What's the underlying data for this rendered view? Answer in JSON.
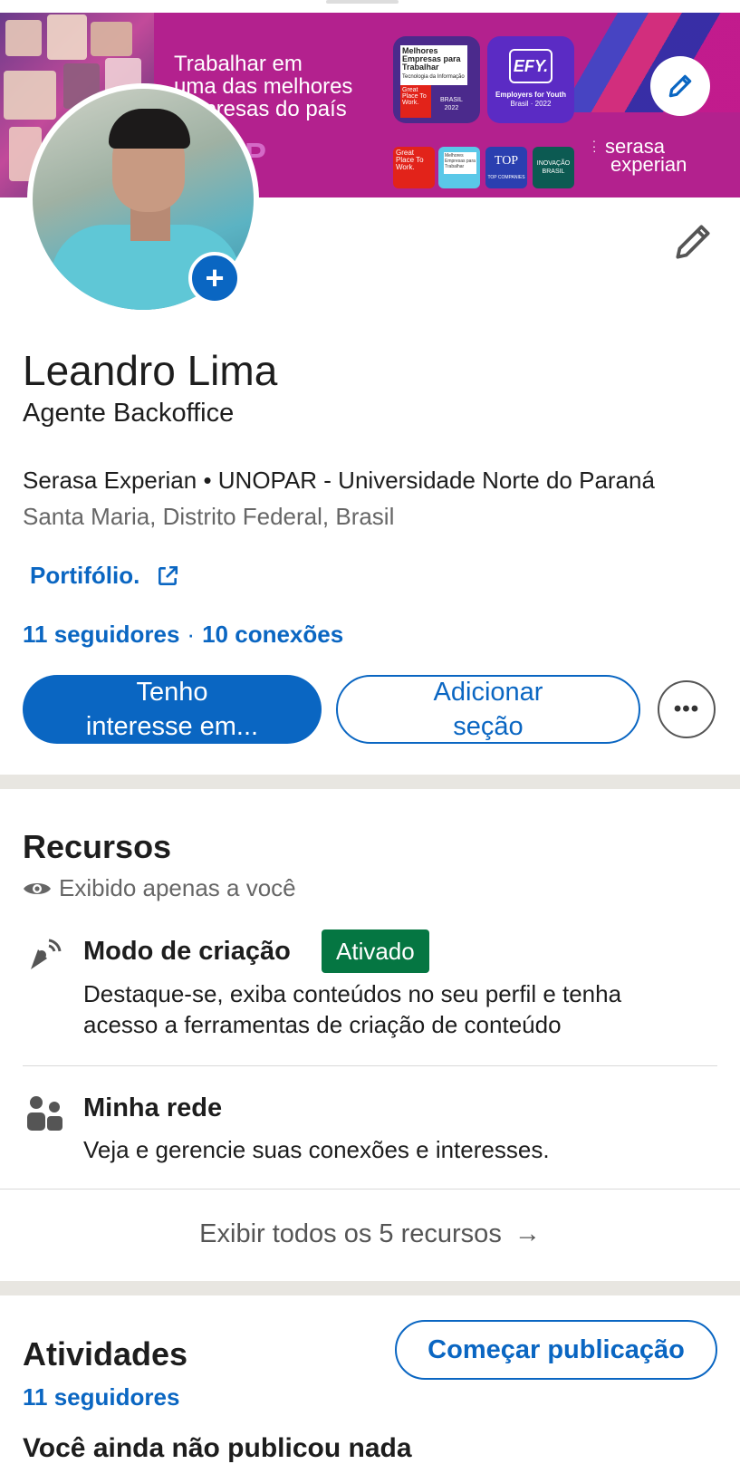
{
  "banner": {
    "text": "Trabalhar em uma das melhores empresas do país",
    "text_lines": [
      "Trabalhar em",
      "uma das melhores",
      "empresas do país"
    ],
    "gptw_letter": "P",
    "badge_best": {
      "title": "Melhores Empresas para Trabalhar",
      "subtitle": "Tecnologia da Informação",
      "gp": "Great Place To Work.",
      "country": "BRASIL",
      "year": "2022"
    },
    "badge_efy": {
      "logo": "EFY.",
      "caption_line1": "Employers for Youth",
      "caption_line2": "Brasil · 2022"
    },
    "small_badges": [
      "Great Place To Work.",
      "Melhores Empresas para Trabalhar",
      "TOP COMPANIES",
      "INOVAÇÃO BRASIL"
    ],
    "brand_line1": "serasa",
    "brand_line2": "experian"
  },
  "profile": {
    "name": "Leandro Lima",
    "headline": "Agente Backoffice",
    "companies": "Serasa Experian • UNOPAR - Universidade Norte do Paraná",
    "location": "Santa Maria, Distrito Federal, Brasil",
    "portfolio_label": "Portifólio.",
    "followers": "11 seguidores",
    "separator": "·",
    "connections": "10 conexões"
  },
  "actions": {
    "primary_label": "Tenho interesse em...",
    "primary_line1": "Tenho",
    "primary_line2": "interesse em...",
    "secondary_line1": "Adicionar",
    "secondary_line2": "seção",
    "more_label": "•••"
  },
  "resources": {
    "title": "Recursos",
    "private_note": "Exibido apenas a você",
    "items": [
      {
        "title": "Modo de criação",
        "status": "Ativado",
        "description_line1": "Destaque-se, exiba conteúdos no seu perfil e tenha",
        "description_line2": "acesso a ferramentas de criação de conteúdo"
      },
      {
        "title": "Minha rede",
        "description_line1": "Veja e gerencie suas conexões e interesses."
      }
    ],
    "show_all": "Exibir todos os 5 recursos",
    "arrow": "→"
  },
  "activity": {
    "title": "Atividades",
    "start_post": "Começar publicação",
    "followers": "11 seguidores",
    "cut_off_text": "Você ainda não publicou nada"
  },
  "colors": {
    "accent": "#0a66c2",
    "banner_bg": "#b3218e",
    "status_green": "#057642",
    "divider": "#e8e6e1"
  },
  "icons": [
    "pencil-icon",
    "add-icon",
    "external-link-icon",
    "eye-icon",
    "broadcast-icon",
    "people-icon",
    "arrow-right-icon",
    "more-icon"
  ]
}
